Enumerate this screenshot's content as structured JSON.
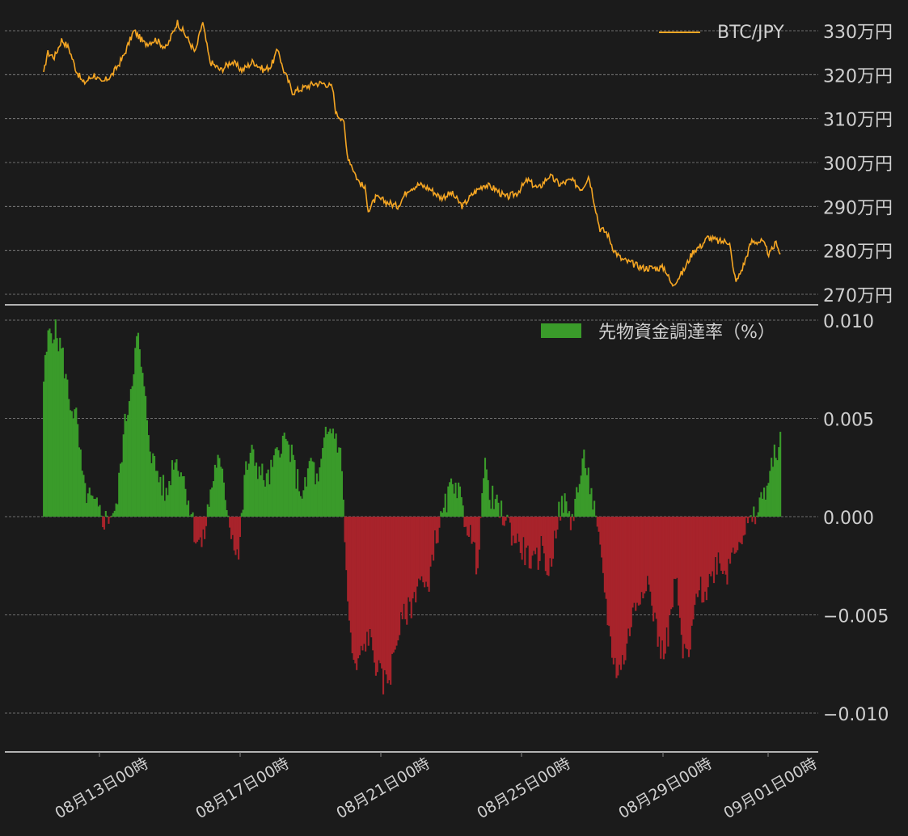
{
  "colors": {
    "background": "#1b1b1b",
    "price_line": "#f5a623",
    "positive_bar": "#3a9b2a",
    "negative_bar": "#a8232b",
    "grid": "#8a8a8a",
    "axis_text": "#cfcfcf"
  },
  "chart_data": [
    {
      "type": "line",
      "legend_position": "top-right",
      "grid": true,
      "ylim": [
        269,
        332
      ],
      "y_ticks": [
        270,
        280,
        290,
        300,
        310,
        320,
        330
      ],
      "y_tick_labels": [
        "270万円",
        "280万円",
        "290万円",
        "300万円",
        "310万円",
        "320万円",
        "330万円"
      ],
      "series": [
        {
          "name": "BTC/JPY",
          "x_days_range": [
            "08月11日06時",
            "09月01日00時"
          ],
          "anchors": [
            [
              0.0,
              320
            ],
            [
              0.1,
              325
            ],
            [
              0.3,
              324
            ],
            [
              0.5,
              328
            ],
            [
              0.7,
              326
            ],
            [
              0.9,
              321
            ],
            [
              1.1,
              318
            ],
            [
              1.4,
              320
            ],
            [
              1.6,
              318
            ],
            [
              1.9,
              320
            ],
            [
              2.2,
              324
            ],
            [
              2.5,
              330
            ],
            [
              2.8,
              327
            ],
            [
              3.1,
              328
            ],
            [
              3.4,
              326
            ],
            [
              3.7,
              332
            ],
            [
              4.0,
              328
            ],
            [
              4.2,
              325
            ],
            [
              4.4,
              332
            ],
            [
              4.6,
              323
            ],
            [
              4.9,
              321
            ],
            [
              5.2,
              323
            ],
            [
              5.5,
              321
            ],
            [
              5.8,
              323
            ],
            [
              6.1,
              321
            ],
            [
              6.3,
              322
            ],
            [
              6.5,
              326
            ],
            [
              6.6,
              322
            ],
            [
              6.9,
              316
            ],
            [
              7.2,
              317
            ],
            [
              7.5,
              318
            ],
            [
              7.8,
              318
            ],
            [
              8.0,
              317
            ],
            [
              8.1,
              311
            ],
            [
              8.3,
              310
            ],
            [
              8.4,
              302
            ],
            [
              8.7,
              296
            ],
            [
              8.9,
              294
            ],
            [
              9.0,
              289
            ],
            [
              9.2,
              292
            ],
            [
              9.5,
              291
            ],
            [
              9.8,
              290
            ],
            [
              10.1,
              294
            ],
            [
              10.4,
              295
            ],
            [
              10.7,
              294
            ],
            [
              11.0,
              292
            ],
            [
              11.3,
              293
            ],
            [
              11.6,
              290
            ],
            [
              11.9,
              293
            ],
            [
              12.2,
              295
            ],
            [
              12.5,
              294
            ],
            [
              12.8,
              292
            ],
            [
              13.1,
              293
            ],
            [
              13.4,
              296
            ],
            [
              13.7,
              294
            ],
            [
              14.0,
              297
            ],
            [
              14.3,
              295
            ],
            [
              14.6,
              296
            ],
            [
              14.9,
              294
            ],
            [
              15.1,
              297
            ],
            [
              15.3,
              289
            ],
            [
              15.4,
              285
            ],
            [
              15.6,
              284
            ],
            [
              15.8,
              280
            ],
            [
              16.0,
              278
            ],
            [
              16.3,
              277
            ],
            [
              16.6,
              276
            ],
            [
              16.9,
              276
            ],
            [
              17.2,
              276
            ],
            [
              17.4,
              272
            ],
            [
              17.7,
              275
            ],
            [
              18.0,
              280
            ],
            [
              18.2,
              281
            ],
            [
              18.4,
              283
            ],
            [
              18.7,
              282
            ],
            [
              19.0,
              282
            ],
            [
              19.1,
              275
            ],
            [
              19.2,
              273
            ],
            [
              19.4,
              277
            ],
            [
              19.6,
              282
            ],
            [
              19.9,
              282
            ],
            [
              20.1,
              279
            ],
            [
              20.3,
              282
            ],
            [
              20.4,
              279
            ]
          ]
        }
      ]
    },
    {
      "type": "bar",
      "legend_position": "top-right",
      "grid": true,
      "ylim": [
        -0.011,
        0.01
      ],
      "y_ticks": [
        0.01,
        0.005,
        0.0,
        -0.005,
        -0.01
      ],
      "y_tick_labels": [
        "0.010",
        "0.005",
        "0.000",
        "−0.005",
        "−0.010"
      ],
      "series": [
        {
          "name": "先物資金調達率（%）",
          "x_days_range": [
            "08月11日06時",
            "09月01日00時"
          ],
          "anchors": [
            [
              0.0,
              0.007
            ],
            [
              0.15,
              0.0095
            ],
            [
              0.3,
              0.0095
            ],
            [
              0.5,
              0.0085
            ],
            [
              0.7,
              0.006
            ],
            [
              0.9,
              0.005
            ],
            [
              1.1,
              0.0015
            ],
            [
              1.3,
              0.0008
            ],
            [
              1.5,
              0.0003
            ],
            [
              1.7,
              -0.0002
            ],
            [
              1.9,
              0.0003
            ],
            [
              2.0,
              0.0001
            ],
            [
              2.2,
              0.004
            ],
            [
              2.4,
              0.0065
            ],
            [
              2.6,
              0.0092
            ],
            [
              2.8,
              0.006
            ],
            [
              3.0,
              0.003
            ],
            [
              3.2,
              0.002
            ],
            [
              3.4,
              0.001
            ],
            [
              3.6,
              0.003
            ],
            [
              3.8,
              0.0025
            ],
            [
              4.0,
              0.001
            ],
            [
              4.2,
              -0.001
            ],
            [
              4.4,
              -0.0015
            ],
            [
              4.6,
              0.001
            ],
            [
              4.8,
              0.003
            ],
            [
              5.0,
              0.0015
            ],
            [
              5.2,
              -0.0008
            ],
            [
              5.4,
              -0.002
            ],
            [
              5.6,
              0.0025
            ],
            [
              5.8,
              0.0032
            ],
            [
              6.0,
              0.0022
            ],
            [
              6.2,
              0.0018
            ],
            [
              6.4,
              0.0028
            ],
            [
              6.6,
              0.004
            ],
            [
              6.8,
              0.0035
            ],
            [
              7.0,
              0.002
            ],
            [
              7.2,
              0.001
            ],
            [
              7.4,
              0.003
            ],
            [
              7.6,
              0.0015
            ],
            [
              7.8,
              0.004
            ],
            [
              8.0,
              0.0045
            ],
            [
              8.2,
              0.0035
            ],
            [
              8.3,
              0.001
            ],
            [
              8.4,
              -0.004
            ],
            [
              8.6,
              -0.008
            ],
            [
              8.8,
              -0.007
            ],
            [
              9.0,
              -0.006
            ],
            [
              9.2,
              -0.0075
            ],
            [
              9.4,
              -0.0085
            ],
            [
              9.6,
              -0.008
            ],
            [
              9.8,
              -0.006
            ],
            [
              10.0,
              -0.005
            ],
            [
              10.2,
              -0.0045
            ],
            [
              10.4,
              -0.003
            ],
            [
              10.6,
              -0.004
            ],
            [
              10.8,
              -0.0015
            ],
            [
              11.0,
              -0.0003
            ],
            [
              11.2,
              0.001
            ],
            [
              11.4,
              0.002
            ],
            [
              11.6,
              0.0003
            ],
            [
              11.8,
              -0.0008
            ],
            [
              12.0,
              -0.0025
            ],
            [
              12.2,
              0.0025
            ],
            [
              12.4,
              0.001
            ],
            [
              12.6,
              0.0003
            ],
            [
              12.8,
              -0.0001
            ],
            [
              13.0,
              -0.001
            ],
            [
              13.2,
              -0.0015
            ],
            [
              13.4,
              -0.002
            ],
            [
              13.6,
              -0.0025
            ],
            [
              13.8,
              -0.0015
            ],
            [
              14.0,
              -0.003
            ],
            [
              14.2,
              -0.0003
            ],
            [
              14.4,
              0.0008
            ],
            [
              14.6,
              -0.0003
            ],
            [
              14.8,
              0.0015
            ],
            [
              15.0,
              0.003
            ],
            [
              15.2,
              0.0008
            ],
            [
              15.3,
              -0.0005
            ],
            [
              15.5,
              -0.003
            ],
            [
              15.7,
              -0.0065
            ],
            [
              15.9,
              -0.008
            ],
            [
              16.1,
              -0.007
            ],
            [
              16.3,
              -0.005
            ],
            [
              16.5,
              -0.004
            ],
            [
              16.7,
              -0.003
            ],
            [
              16.9,
              -0.005
            ],
            [
              17.1,
              -0.007
            ],
            [
              17.3,
              -0.006
            ],
            [
              17.5,
              -0.003
            ],
            [
              17.7,
              -0.007
            ],
            [
              17.9,
              -0.007
            ],
            [
              18.1,
              -0.0035
            ],
            [
              18.3,
              -0.004
            ],
            [
              18.5,
              -0.003
            ],
            [
              18.7,
              -0.002
            ],
            [
              18.9,
              -0.003
            ],
            [
              19.1,
              -0.0015
            ],
            [
              19.3,
              -0.001
            ],
            [
              19.5,
              -0.0005
            ],
            [
              19.7,
              -0.0001
            ],
            [
              19.9,
              0.001
            ],
            [
              20.1,
              0.002
            ],
            [
              20.3,
              0.0035
            ],
            [
              20.4,
              0.0038
            ]
          ]
        }
      ]
    }
  ],
  "x_axis": {
    "tick_labels": [
      "08月13日00時",
      "08月17日00時",
      "08月21日00時",
      "08月25日00時",
      "08月29日00時",
      "09月01日00時"
    ]
  }
}
